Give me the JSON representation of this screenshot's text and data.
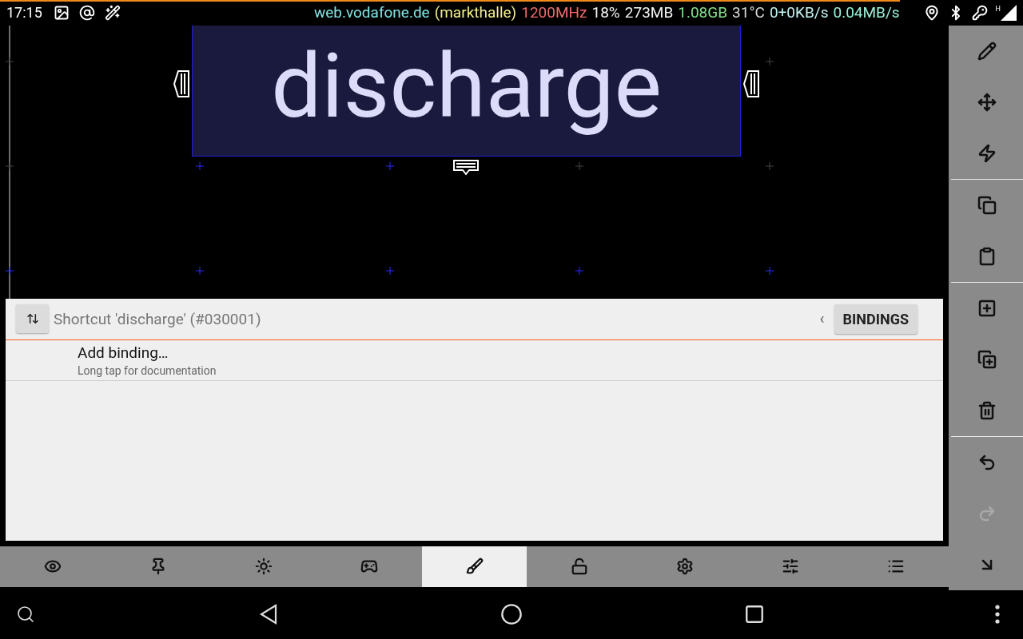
{
  "status_bar": {
    "time": "17:15",
    "level": 0.88,
    "left_icons": [
      {
        "kind": "image"
      },
      {
        "kind": "at"
      },
      {
        "kind": "wand"
      }
    ],
    "stats": [
      {
        "text": "web.vodafone.de",
        "color": "#80e4e4"
      },
      {
        "text": "(markthalle)",
        "color": "#f2ee90"
      },
      {
        "text": "1200MHz",
        "color": "#f06a6a"
      },
      {
        "text": "18%",
        "color": "#f4f4f4"
      },
      {
        "text": "273MB",
        "color": "#f4f4f4"
      },
      {
        "text": "1.08GB",
        "color": "#86e08a"
      },
      {
        "text": "31°C",
        "color": "#d8d8d8"
      },
      {
        "text": "0+0KB/s",
        "color": "#c4f2f2"
      },
      {
        "text": "0.04MB/s",
        "color": "#9af0d8"
      }
    ],
    "right_icons": [
      {
        "kind": "location"
      },
      {
        "kind": "bluetooth"
      },
      {
        "kind": "key"
      },
      {
        "kind": "signal"
      }
    ],
    "network_type": "H"
  },
  "canvas": {
    "widget": {
      "label": "discharge",
      "selected": true
    }
  },
  "panel": {
    "title": "Shortcut 'discharge' (#030001)",
    "collapse_arrow": "‹",
    "button": "BINDINGS",
    "items": [
      {
        "title": "Add binding…",
        "subtitle": "Long tap for documentation"
      }
    ]
  },
  "toolbar": {
    "groups": [
      [
        {
          "kind": "pencil",
          "disabled": false
        },
        {
          "kind": "move",
          "disabled": false
        },
        {
          "kind": "bolt",
          "disabled": false
        }
      ],
      [
        {
          "kind": "copy",
          "disabled": false
        },
        {
          "kind": "clipboard",
          "disabled": false
        }
      ],
      [
        {
          "kind": "add",
          "disabled": false
        },
        {
          "kind": "add-copy",
          "disabled": false
        },
        {
          "kind": "trash",
          "disabled": false
        }
      ],
      [
        {
          "kind": "undo",
          "disabled": false
        },
        {
          "kind": "redo",
          "disabled": true
        },
        {
          "kind": "corner-arrow",
          "disabled": false
        }
      ]
    ]
  },
  "tabs": [
    {
      "kind": "eye",
      "selected": false
    },
    {
      "kind": "pin",
      "selected": false
    },
    {
      "kind": "sun",
      "selected": false
    },
    {
      "kind": "gamepad",
      "selected": false
    },
    {
      "kind": "brush",
      "selected": true
    },
    {
      "kind": "lock",
      "selected": false
    },
    {
      "kind": "gear",
      "selected": false
    },
    {
      "kind": "sliders",
      "selected": false
    },
    {
      "kind": "list",
      "selected": false
    }
  ],
  "nav_bar": [
    {
      "kind": "search"
    },
    {
      "kind": "back"
    },
    {
      "kind": "home"
    },
    {
      "kind": "recents"
    },
    {
      "kind": "more"
    }
  ]
}
